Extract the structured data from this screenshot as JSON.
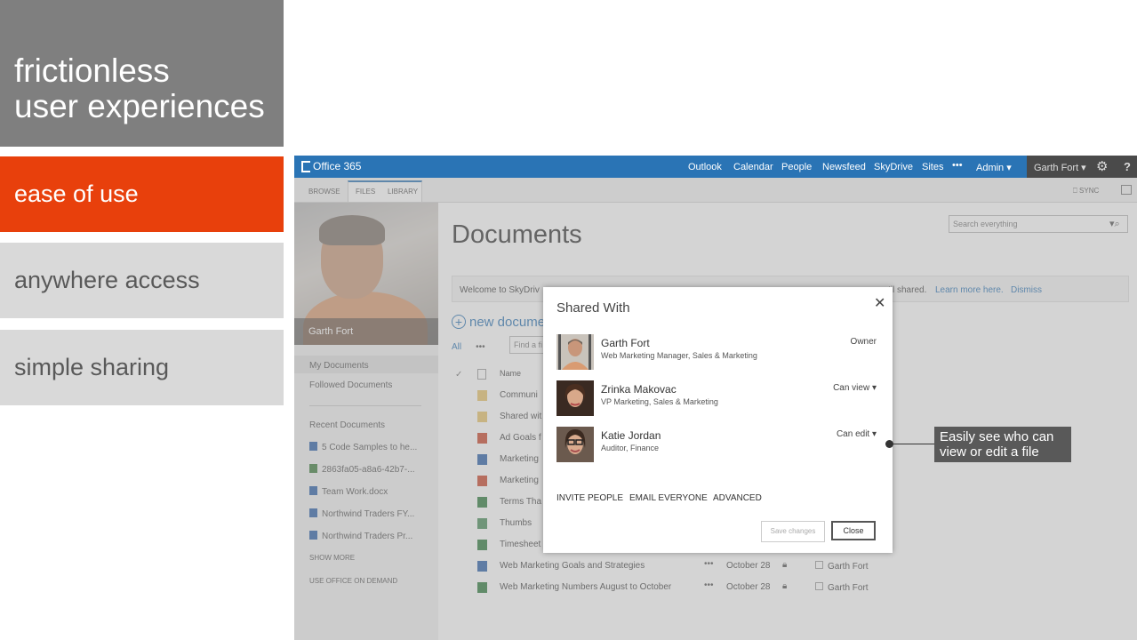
{
  "slide": {
    "title_line1": "frictionless",
    "title_line2": "user experiences",
    "features": [
      "ease of use",
      "anywhere access",
      "simple sharing"
    ],
    "callout": "Easily see who can view or edit a file"
  },
  "colors": {
    "accent": "#e8400c",
    "gray_dark": "#7f7f7f",
    "gray_light": "#d9d9d9",
    "suite_blue": "#2a74b5"
  },
  "suitebar": {
    "logo": "Office 365",
    "nav": [
      "Outlook",
      "Calendar",
      "People",
      "Newsfeed",
      "SkyDrive",
      "Sites",
      "•••",
      "Admin ▾"
    ],
    "user": "Garth Fort ▾",
    "settings_icon": "⚙",
    "help_icon": "?"
  },
  "ribbon": {
    "tabs": [
      "BROWSE",
      "FILES",
      "LIBRARY"
    ],
    "sync": "SYNC"
  },
  "leftnav": {
    "profile_name": "Garth Fort",
    "items": [
      "My Documents",
      "Followed Documents"
    ],
    "recent_header": "Recent Documents",
    "recent": [
      "5 Code Samples to he...",
      "2863fa05-a8a6-42b7-...",
      "Team Work.docx",
      "Northwind Traders FY...",
      "Northwind Traders Pr..."
    ],
    "show_more": "SHOW MORE",
    "office_on_demand": "USE OFFICE ON DEMAND"
  },
  "main": {
    "title": "Documents",
    "search_placeholder": "Search everything",
    "welcome_start": "Welcome to SkyDriv",
    "welcome_end": "til shared.",
    "learn_more": "Learn more here.",
    "dismiss": "Dismiss",
    "new_document": "new docume",
    "all": "All",
    "more": "•••",
    "find_placeholder": "Find a fi",
    "col_name": "Name",
    "files": [
      {
        "name": "Communi",
        "type": "folder"
      },
      {
        "name": "Shared wit",
        "type": "folder"
      },
      {
        "name": "Ad Goals f",
        "type": "ppt"
      },
      {
        "name": "Marketing",
        "type": "doc"
      },
      {
        "name": "Marketing",
        "type": "ppt"
      },
      {
        "name": "Terms Tha",
        "type": "xls"
      },
      {
        "name": "Thumbs",
        "type": "img"
      },
      {
        "name": "Timesheet",
        "type": "xls"
      },
      {
        "name": "Web Marketing Goals and Strategies",
        "type": "doc",
        "date": "October 28",
        "shared": "Garth Fort"
      },
      {
        "name": "Web Marketing Numbers August to October",
        "type": "xls",
        "date": "October 28",
        "shared": "Garth Fort"
      }
    ]
  },
  "dialog": {
    "title": "Shared With",
    "close_x": "✕",
    "people": [
      {
        "name": "Garth Fort",
        "role": "Web Marketing Manager, Sales & Marketing",
        "perm": "Owner"
      },
      {
        "name": "Zrinka Makovac",
        "role": "VP Marketing, Sales & Marketing",
        "perm": "Can view ▾"
      },
      {
        "name": "Katie Jordan",
        "role": "Auditor, Finance",
        "perm": "Can edit ▾"
      }
    ],
    "actions": [
      "INVITE PEOPLE",
      "EMAIL EVERYONE",
      "ADVANCED"
    ],
    "save": "Save changes",
    "close": "Close"
  }
}
